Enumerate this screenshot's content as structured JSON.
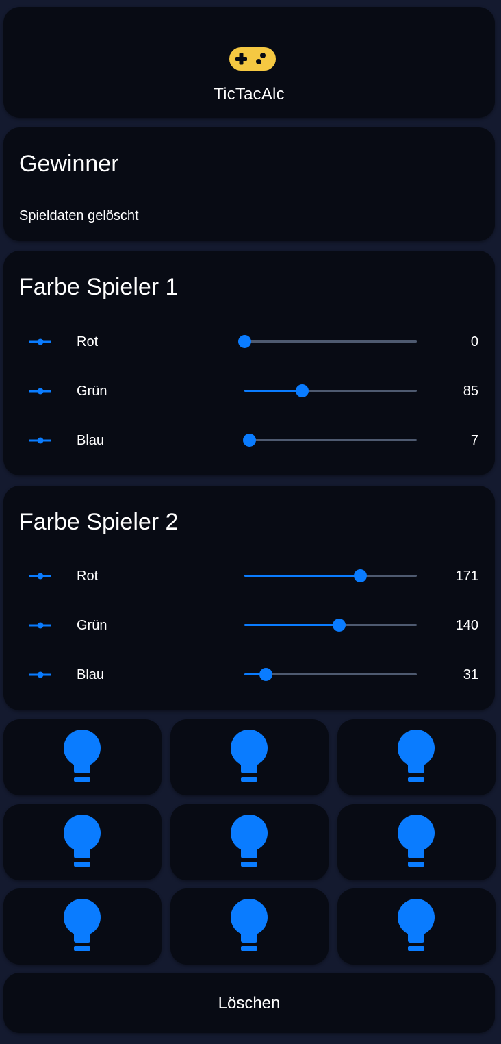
{
  "header": {
    "title": "TicTacAlc",
    "icon": "gamepad-icon",
    "icon_color": "#f5c842"
  },
  "winner": {
    "heading": "Gewinner",
    "status": "Spieldaten gelöscht"
  },
  "player1": {
    "heading": "Farbe Spieler 1",
    "sliders": [
      {
        "label": "Rot",
        "value": "0",
        "fraction": 0.0
      },
      {
        "label": "Grün",
        "value": "85",
        "fraction": 0.333
      },
      {
        "label": "Blau",
        "value": "7",
        "fraction": 0.027
      }
    ]
  },
  "player2": {
    "heading": "Farbe Spieler 2",
    "sliders": [
      {
        "label": "Rot",
        "value": "171",
        "fraction": 0.671
      },
      {
        "label": "Grün",
        "value": "140",
        "fraction": 0.549
      },
      {
        "label": "Blau",
        "value": "31",
        "fraction": 0.122
      }
    ]
  },
  "board": {
    "icon": "lightbulb-icon",
    "icon_color": "#0a7cff",
    "cells": 9
  },
  "actions": {
    "clear_label": "Löschen"
  },
  "colors": {
    "accent": "#0a7cff",
    "background": "#141a2f",
    "card": "#080b14",
    "track": "#4e5a70"
  }
}
